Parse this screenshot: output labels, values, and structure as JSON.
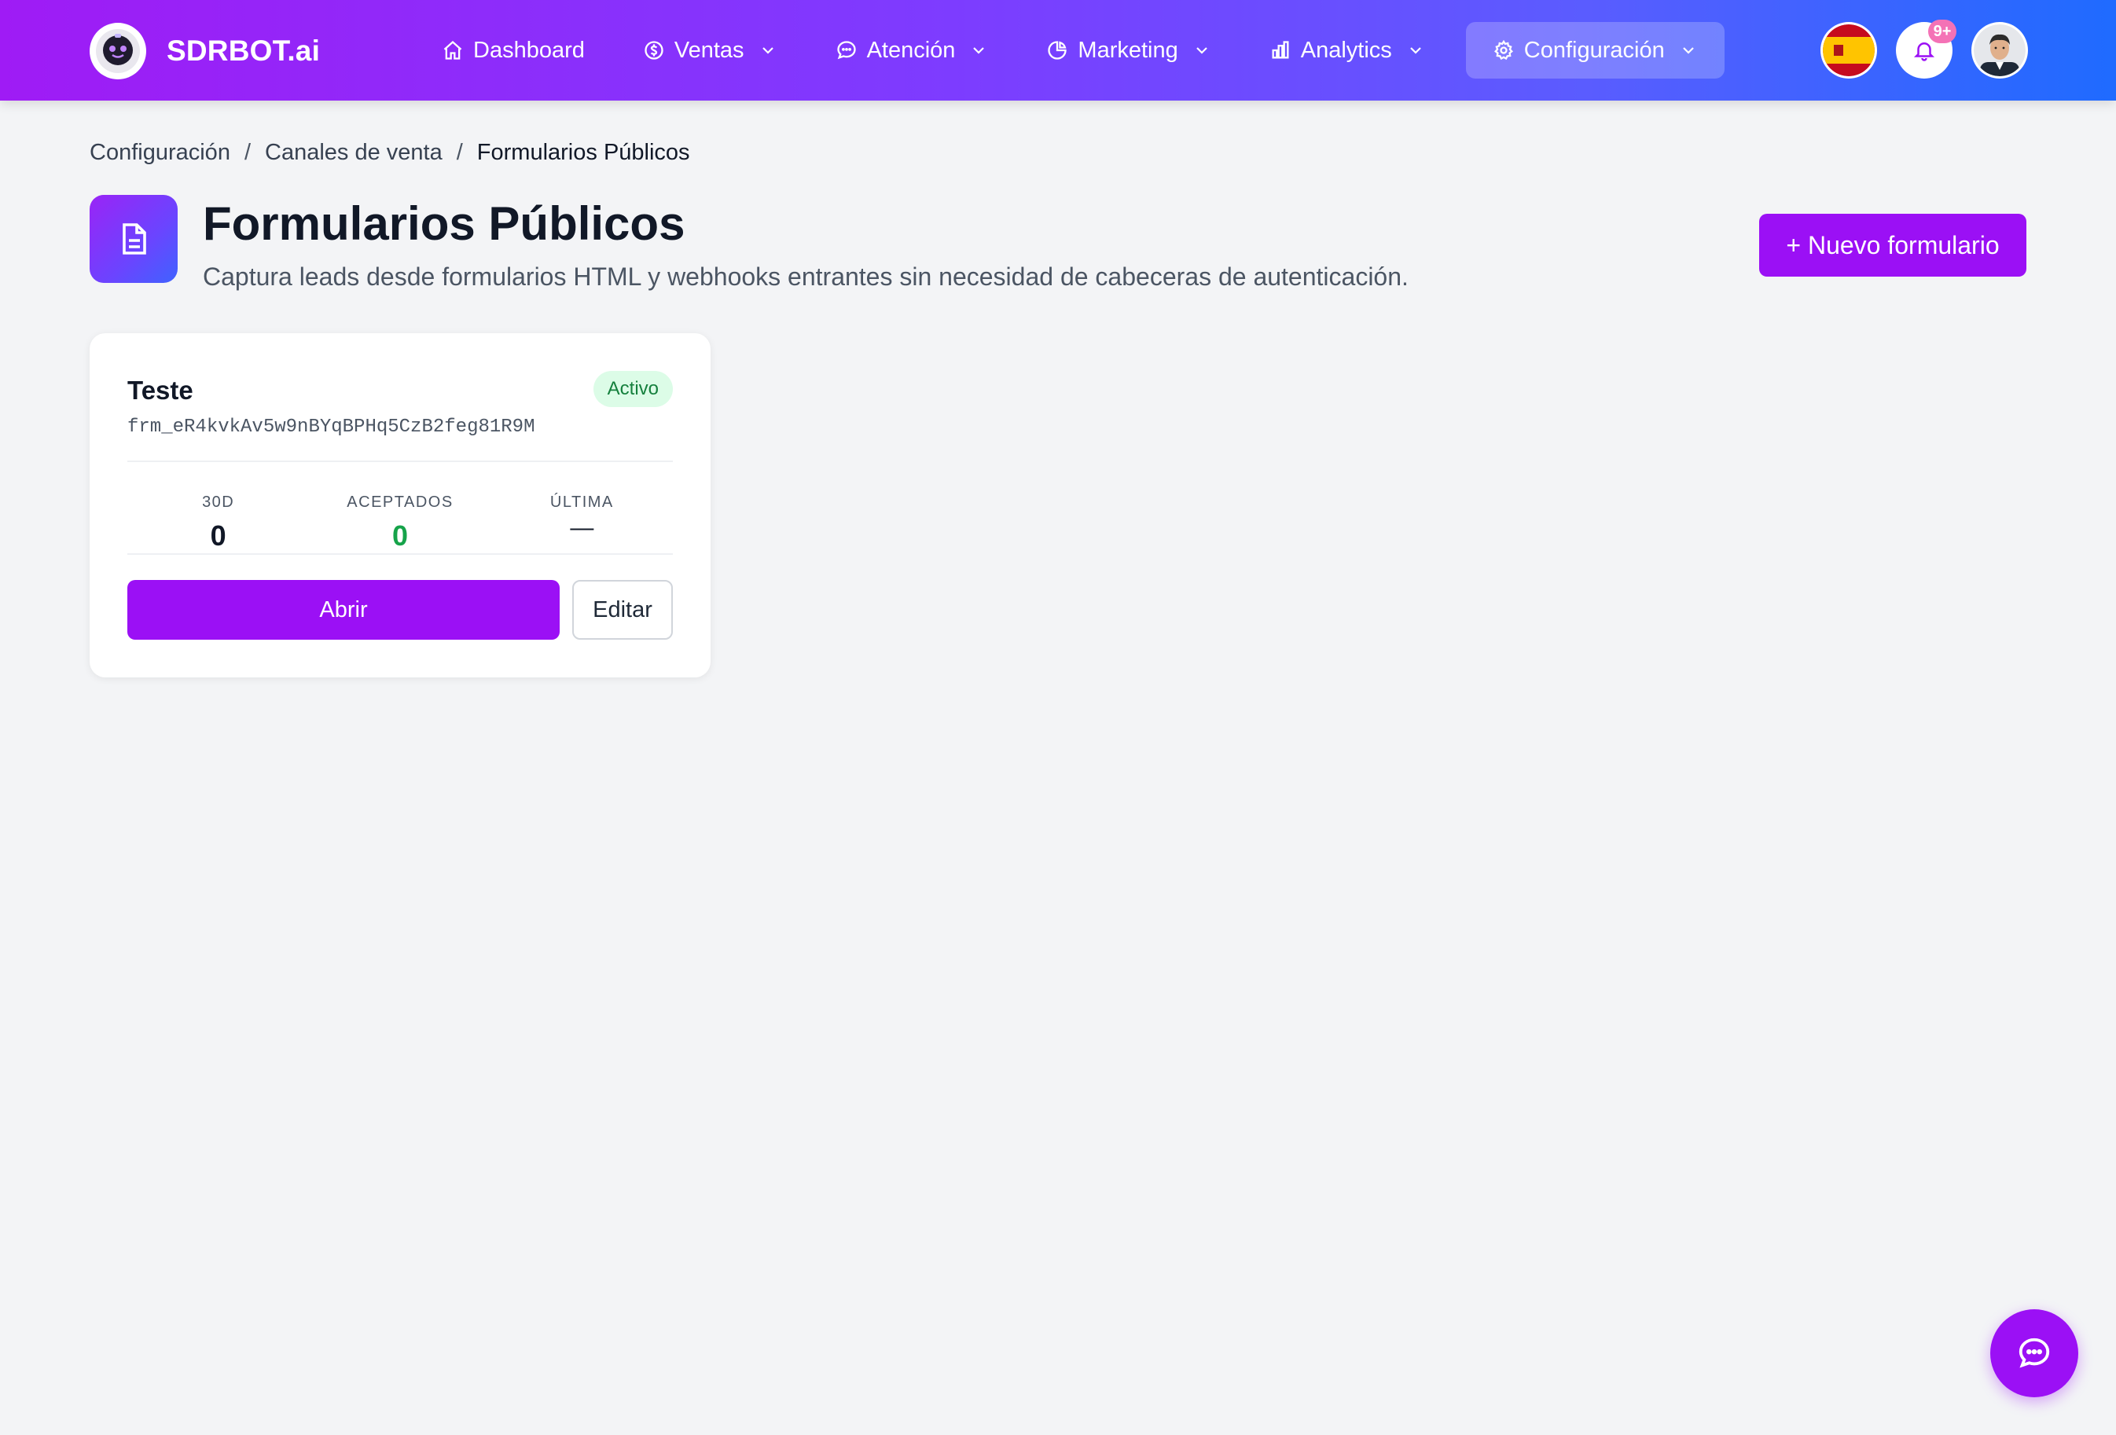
{
  "brand": {
    "name": "SDRBOT.ai"
  },
  "nav": {
    "items": [
      {
        "label": "Dashboard",
        "icon": "home-icon"
      },
      {
        "label": "Ventas",
        "icon": "dollar-icon"
      },
      {
        "label": "Atención",
        "icon": "chat-bubble-icon"
      },
      {
        "label": "Marketing",
        "icon": "pie-chart-icon"
      },
      {
        "label": "Analytics",
        "icon": "bar-chart-icon"
      },
      {
        "label": "Configuración",
        "icon": "gear-icon"
      }
    ]
  },
  "notifications": {
    "badge": "9+"
  },
  "breadcrumb": {
    "items": [
      "Configuración",
      "Canales de venta",
      "Formularios Públicos"
    ],
    "separator": "/"
  },
  "header": {
    "title": "Formularios Públicos",
    "subtitle": "Captura leads desde formularios HTML y webhooks entrantes sin necesidad de cabeceras de autenticación.",
    "new_button": "+ Nuevo formulario"
  },
  "forms": [
    {
      "name": "Teste",
      "id": "frm_eR4kvkAv5w9nBYqBPHq5CzB2feg81R9M",
      "status": "Activo",
      "stats": {
        "d30_label": "30D",
        "d30_value": "0",
        "accepted_label": "ACEPTADOS",
        "accepted_value": "0",
        "last_label": "ÚLTIMA",
        "last_value": "—"
      },
      "open_label": "Abrir",
      "edit_label": "Editar"
    }
  ],
  "colors": {
    "primary": "#9b10f5",
    "success": "#16a34a",
    "success_bg": "#dcfce7",
    "background": "#f3f4f6"
  }
}
